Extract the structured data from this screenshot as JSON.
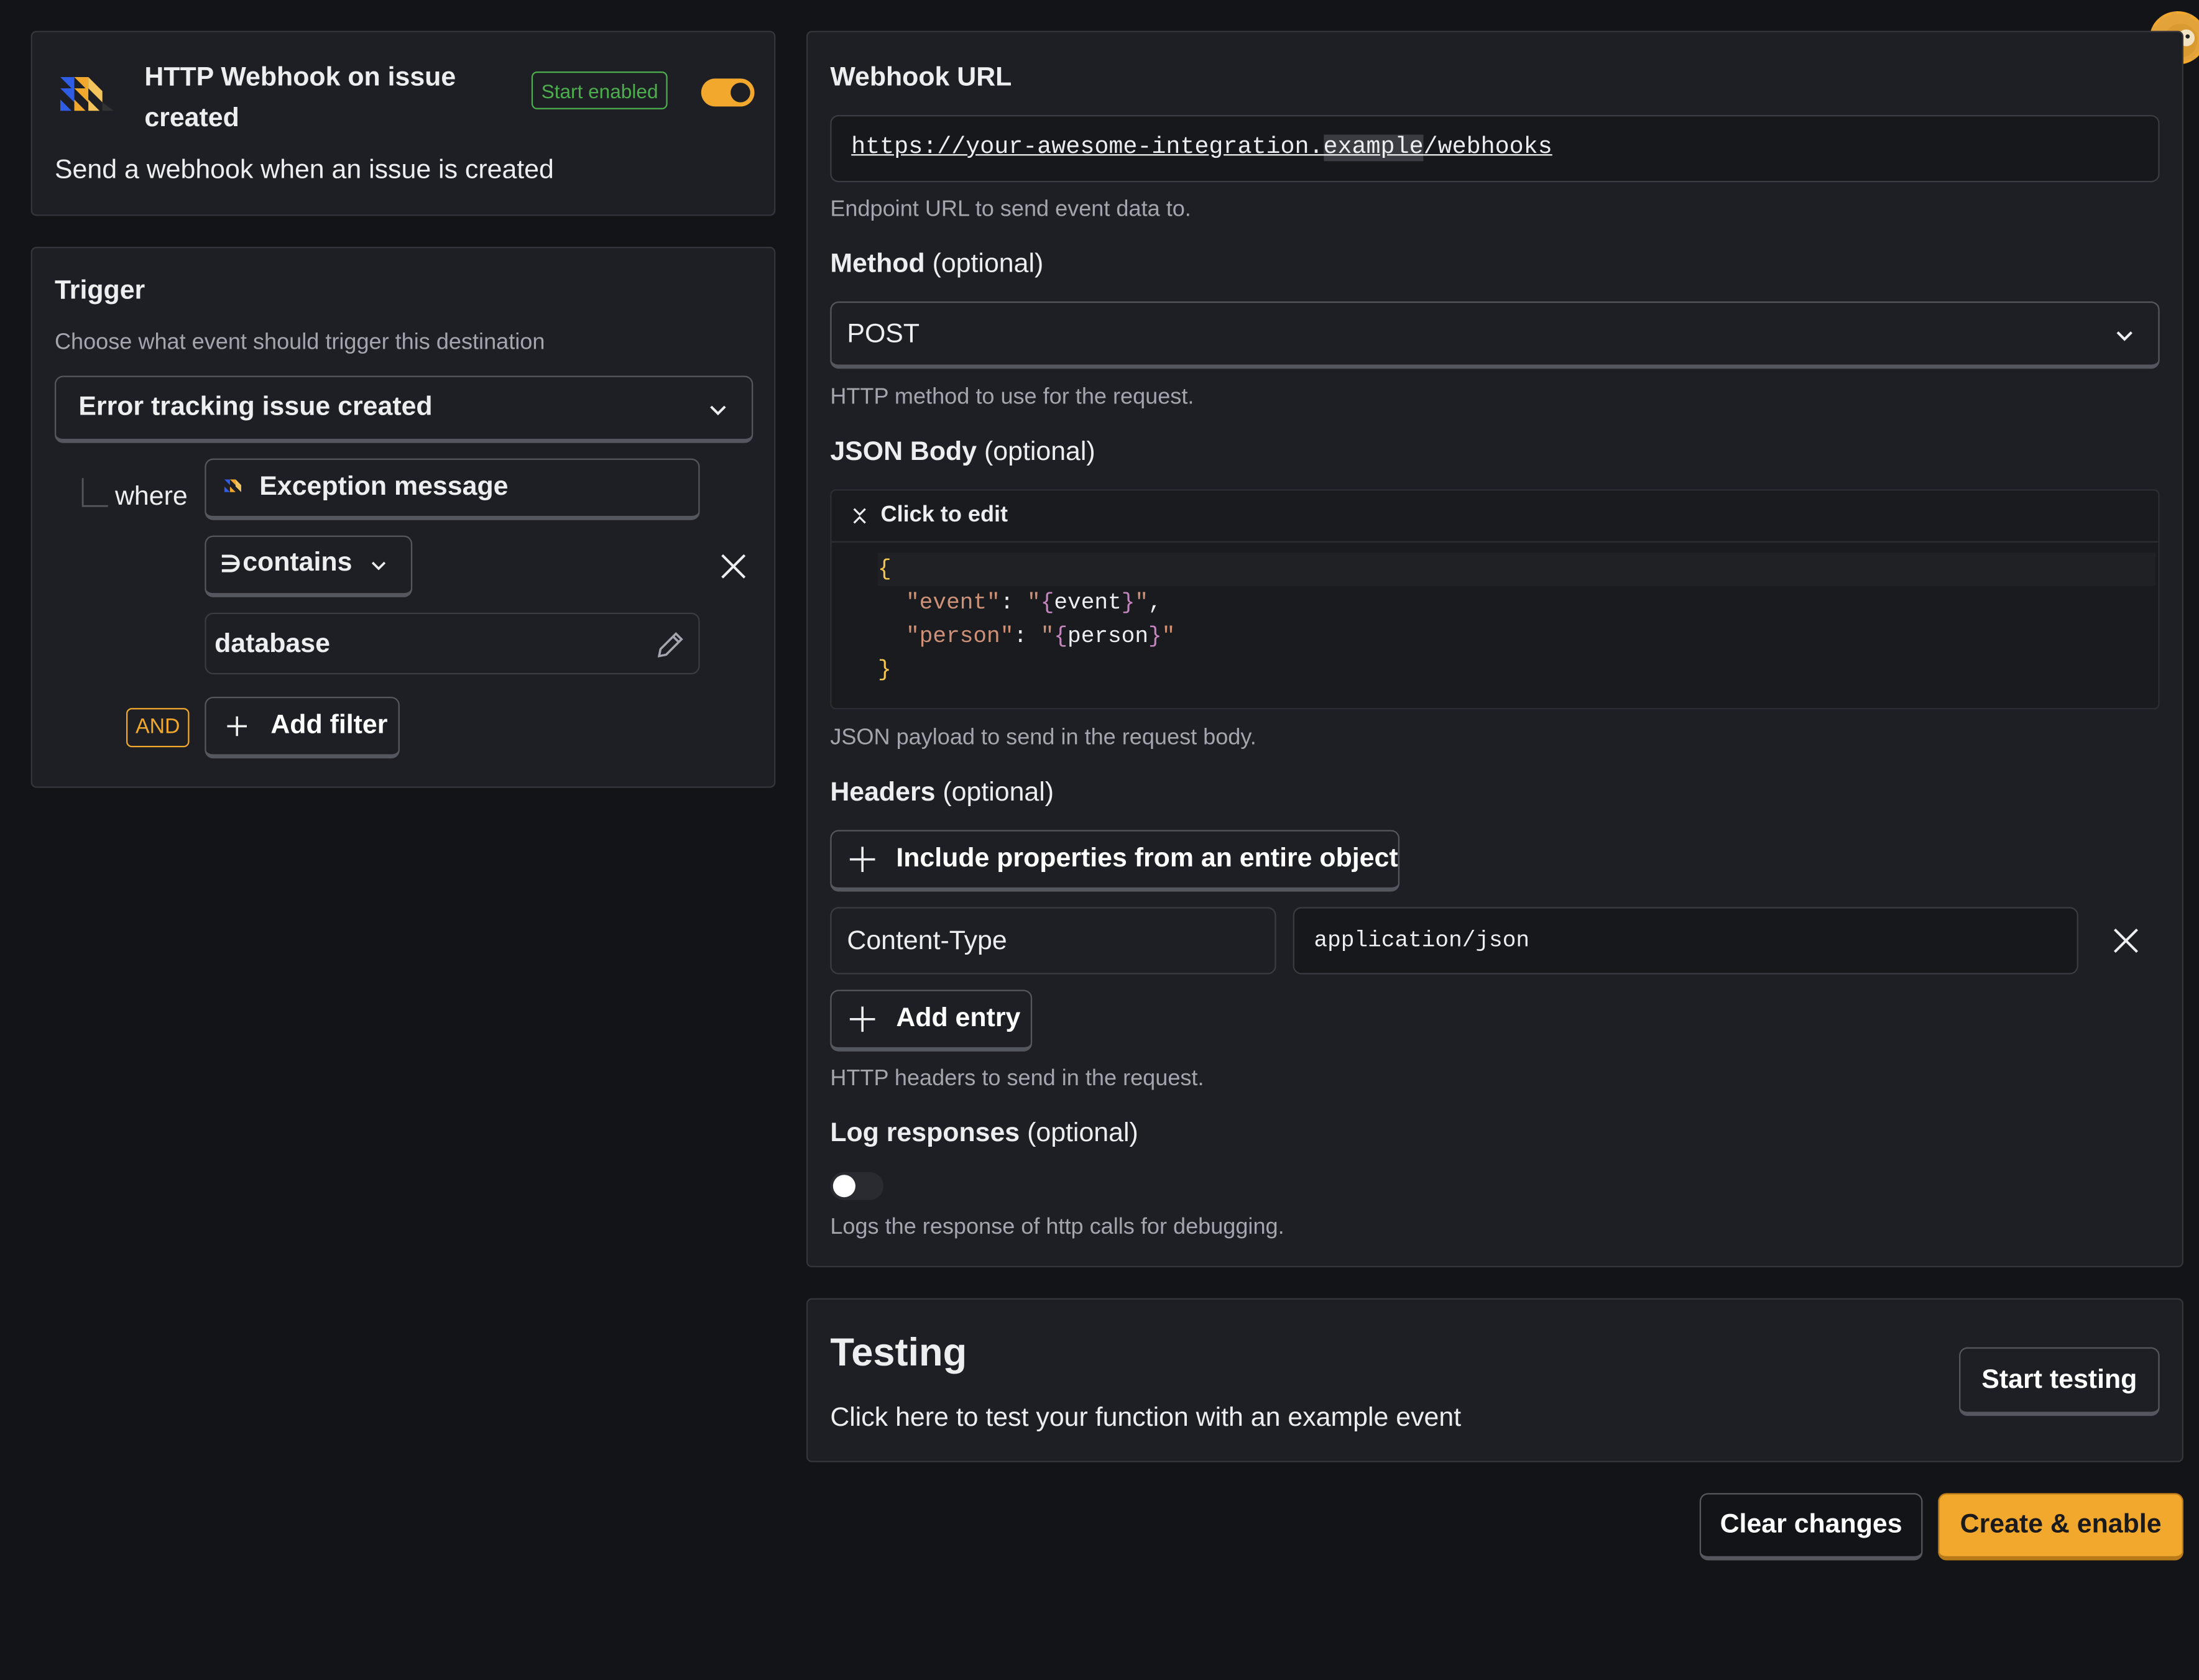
{
  "app": {
    "name": "HTTP Webhook on issue created",
    "description": "Send a webhook when an issue is created",
    "start_enabled_badge": "Start enabled",
    "enabled": true
  },
  "trigger": {
    "title": "Trigger",
    "subtitle": "Choose what event should trigger this destination",
    "event": "Error tracking issue created",
    "where_label": "where",
    "filter_property": "Exception message",
    "filter_operator_symbol": "∋",
    "filter_operator": "contains",
    "filter_value": "database",
    "and_label": "AND",
    "add_filter_label": "Add filter"
  },
  "webhook": {
    "url_label": "Webhook URL",
    "url_value_pre": "https://your-awesome-integration.",
    "url_value_hl": "example",
    "url_value_post": "/webhooks",
    "url_help": "Endpoint URL to send event data to.",
    "method_label": "Method",
    "optional": "(optional)",
    "method_value": "POST",
    "method_help": "HTTP method to use for the request.",
    "body_label": "JSON Body",
    "click_to_edit": "Click to edit",
    "code": {
      "open": "{",
      "k1": "\"event\"",
      "v1_q1": "\"",
      "v1_b1": "{",
      "v1_txt": "event",
      "v1_b2": "}",
      "v1_q2": "\"",
      "k2": "\"person\"",
      "v2_txt": "person",
      "close": "}",
      "colon": ": ",
      "comma": ","
    },
    "body_help": "JSON payload to send in the request body.",
    "headers_label": "Headers",
    "include_props_label": "Include properties from an entire object",
    "header_key": "Content-Type",
    "header_value": "application/json",
    "add_entry_label": "Add entry",
    "headers_help": "HTTP headers to send in the request.",
    "log_label": "Log responses",
    "log_help": "Logs the response of http calls for debugging."
  },
  "testing": {
    "title": "Testing",
    "subtitle": "Click here to test your function with an example event",
    "start_label": "Start testing"
  },
  "footer": {
    "clear_label": "Clear changes",
    "create_label": "Create & enable"
  },
  "colors": {
    "accent": "#f1a82c",
    "badge_green": "#4cae4c",
    "code_orange": "#ce9178",
    "code_brace": "#f5c64f",
    "code_purple": "#c586c0"
  }
}
